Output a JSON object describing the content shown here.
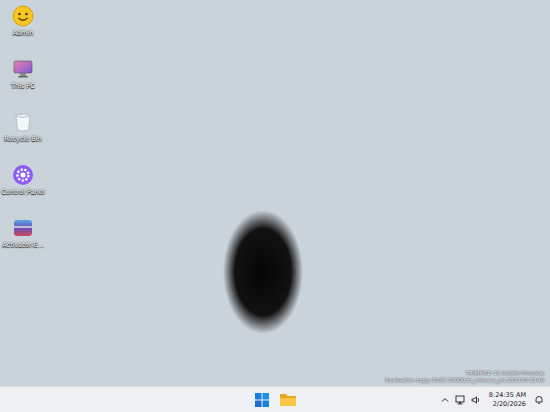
{
  "desktop": {
    "icons": [
      {
        "label": "Admin",
        "kind": "user"
      },
      {
        "label": "This PC",
        "kind": "pc"
      },
      {
        "label": "Recycle Bin",
        "kind": "bin"
      },
      {
        "label": "Control Panel",
        "kind": "control"
      },
      {
        "label": "Activator-E...",
        "kind": "app"
      }
    ]
  },
  "watermark": {
    "lines": [
      "TRIMMED 11 Insider Preview",
      "Evaluation copy. Build 28000.br_release_ph.251110-1140"
    ]
  },
  "clock": {
    "time": "8:24:35 AM",
    "date": "2/20/2026"
  }
}
